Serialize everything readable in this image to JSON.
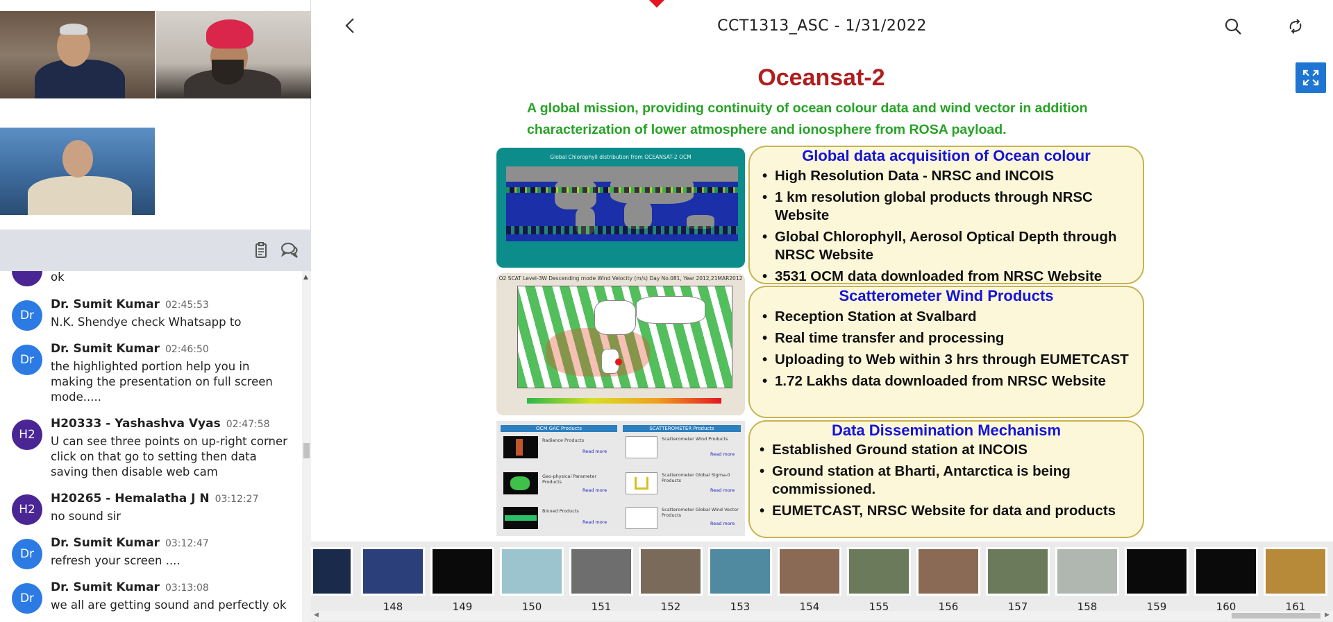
{
  "header": {
    "title": "CCT1313_ASC - 1/31/2022"
  },
  "chat": {
    "partial_text": "ok",
    "messages": [
      {
        "avatar": "Dr",
        "name": "Dr. Sumit Kumar",
        "time": "02:45:53",
        "text": "N.K. Shendye check Whatsapp to"
      },
      {
        "avatar": "Dr",
        "name": "Dr. Sumit Kumar",
        "time": "02:46:50",
        "text": "the highlighted portion help you in making the presentation on full screen mode....."
      },
      {
        "avatar": "H2",
        "name": "H20333 - Yashashva Vyas",
        "time": "02:47:58",
        "text": "U can see three points on up-right corner click on that go to setting then data saving then disable web cam"
      },
      {
        "avatar": "H2",
        "name": "H20265 - Hemalatha J N",
        "time": "03:12:27",
        "text": "no sound sir"
      },
      {
        "avatar": "Dr",
        "name": "Dr. Sumit Kumar",
        "time": "03:12:47",
        "text": "refresh your screen ...."
      },
      {
        "avatar": "Dr",
        "name": "Dr. Sumit Kumar",
        "time": "03:13:08",
        "text": "we all are getting sound and perfectly ok"
      }
    ]
  },
  "slide": {
    "title": "Oceansat-2",
    "subtitle": "A global mission, providing continuity of ocean colour data and wind vector in addition characterization of lower atmosphere and ionosphere from ROSA payload.",
    "image1_caption": "Global Chlorophyll distribution from OCEANSAT-2 OCM",
    "image2_caption": "O2 SCAT Level-3W Descending mode Wind Velocity (m/s) Day No.081, Year 2012,21MAR2012",
    "image3": {
      "col1_header": "OCM GAC Products",
      "col2_header": "SCATTEROMETER Products",
      "col1_items": [
        "Radiance Products",
        "Geo-physical Parameter Products",
        "Binned Products"
      ],
      "col2_items": [
        "Scatterometer Wind Products",
        "Scatterometer Global Sigma-0 Products",
        "Scatterometer Global Wind Vector Products"
      ],
      "read_more": "Read more"
    },
    "panels": [
      {
        "heading": "Global data acquisition of Ocean colour",
        "bullets": [
          "High Resolution Data - NRSC and INCOIS",
          "1 km resolution global products through NRSC Website",
          "Global Chlorophyll, Aerosol Optical Depth through NRSC Website",
          "3531 OCM data downloaded from NRSC Website"
        ]
      },
      {
        "heading": "Scatterometer Wind Products",
        "bullets": [
          "Reception Station at Svalbard",
          "Real time transfer and processing",
          "Uploading to Web within 3 hrs  through EUMETCAST",
          "1.72 Lakhs data downloaded from NRSC Website"
        ]
      },
      {
        "heading": "Data Dissemination Mechanism",
        "bullets": [
          "Established Ground station at INCOIS",
          "Ground station at Bharti, Antarctica is being commissioned.",
          "EUMETCAST, NRSC Website for data and products"
        ]
      }
    ]
  },
  "thumbnails": [
    {
      "num": "",
      "color": "#1a2a4a"
    },
    {
      "num": "148",
      "color": "#2b3f7a"
    },
    {
      "num": "149",
      "color": "#0a0a0a"
    },
    {
      "num": "150",
      "color": "#9bc4cf"
    },
    {
      "num": "151",
      "color": "#6e6e6e"
    },
    {
      "num": "152",
      "color": "#7a6a5a"
    },
    {
      "num": "153",
      "color": "#4f8aa0"
    },
    {
      "num": "154",
      "color": "#8a6a55"
    },
    {
      "num": "155",
      "color": "#6c7a5c"
    },
    {
      "num": "156",
      "color": "#8a6a55"
    },
    {
      "num": "157",
      "color": "#6c7a5c"
    },
    {
      "num": "158",
      "color": "#b0b6b0"
    },
    {
      "num": "159",
      "color": "#0a0a0a"
    },
    {
      "num": "160",
      "color": "#0a0a0a"
    },
    {
      "num": "161",
      "color": "#b78a3a"
    }
  ],
  "colors": {
    "accent": "#1f76d2",
    "avatar_dr": "#2c7be5",
    "avatar_h2": "#4a2594",
    "slide_title": "#b01e1e",
    "slide_subtitle": "#27a327",
    "panel_heading": "#1414d8"
  }
}
